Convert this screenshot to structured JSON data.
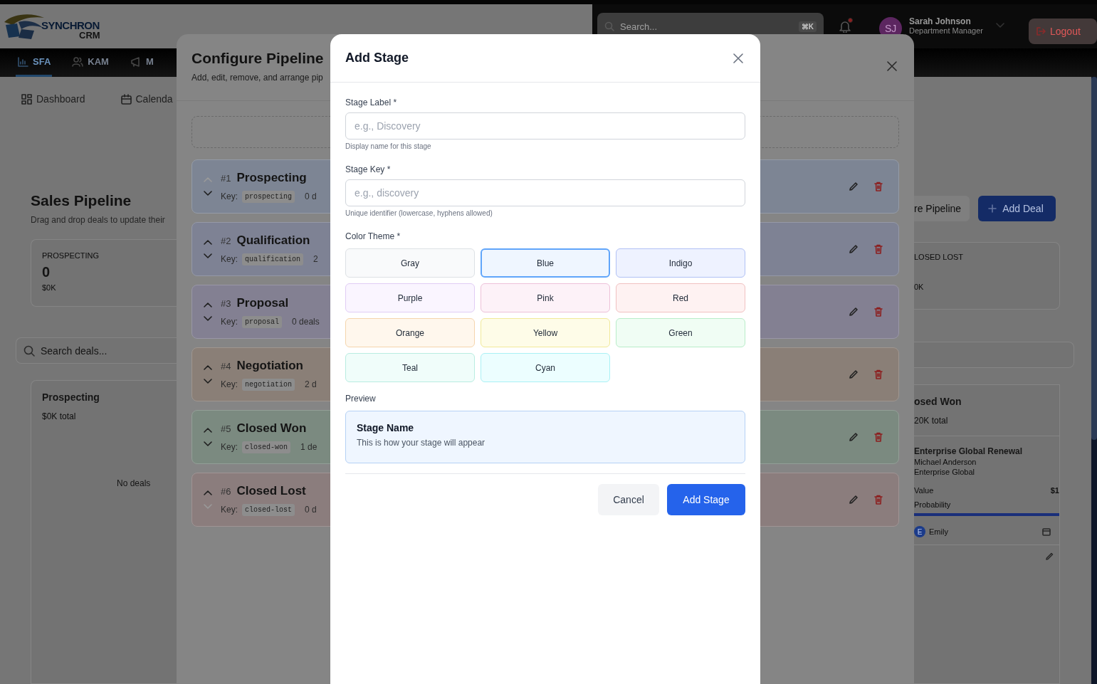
{
  "header": {
    "logo": {
      "word": "SYNCHRON",
      "sub": "CRM"
    },
    "search": {
      "placeholder": "Search...",
      "shortcut": "⌘K"
    },
    "notifications": {
      "unread": true
    },
    "user": {
      "initials": "SJ",
      "name": "Sarah Johnson",
      "role": "Department Manager"
    },
    "logout": "Logout"
  },
  "module_tabs": [
    {
      "label": "SFA",
      "selected": true
    },
    {
      "label": "KAM",
      "selected": false
    },
    {
      "label": "M",
      "selected": false
    }
  ],
  "sub_tabs": [
    {
      "label": "Dashboard"
    },
    {
      "label": "Calenda"
    }
  ],
  "pipeline_page": {
    "title": "Sales Pipeline",
    "subtitle": "Drag and drop deals to update their",
    "configure_button": "re Pipeline",
    "add_deal_button": "Add Deal",
    "stat_cards": [
      {
        "label": "PROSPECTING",
        "count": "0",
        "value": "$0K"
      },
      {
        "label": "LOSED LOST",
        "value": "0K"
      }
    ],
    "search_placeholder": "Search deals...",
    "columns": [
      {
        "title": "Prospecting",
        "total": "$0K total",
        "empty_text": "No deals"
      },
      {
        "title": "osed Won",
        "total": "20K total",
        "deals": [
          {
            "title": "Enterprise Global Renewal",
            "contact": "Michael Anderson",
            "company": "Enterprise Global",
            "value_label": "Value",
            "value": "$1",
            "probability_label": "Probability",
            "level": 1,
            "owner_initial": "E",
            "owner": "Emily"
          }
        ]
      }
    ]
  },
  "configure_pipeline": {
    "title": "Configure Pipeline",
    "subtitle": "Add, edit, remove, and arrange pip",
    "stages": [
      {
        "number": "#1",
        "name": "Prospecting",
        "key_label": "Key:",
        "key": "prospecting",
        "deals": "0 d",
        "color": "#7d8594",
        "up_disabled": true,
        "down_disabled": false
      },
      {
        "number": "#2",
        "name": "Qualification",
        "key_label": "Key:",
        "key": "qualification",
        "deals": "2",
        "color": "#7e8294",
        "up_disabled": false,
        "down_disabled": false
      },
      {
        "number": "#3",
        "name": "Proposal",
        "key_label": "Key:",
        "key": "proposal",
        "deals": "0 deals",
        "color": "#838092",
        "up_disabled": false,
        "down_disabled": false
      },
      {
        "number": "#4",
        "name": "Negotiation",
        "key_label": "Key:",
        "key": "negotiation",
        "deals": "2 d",
        "color": "#8a7f77",
        "up_disabled": false,
        "down_disabled": false
      },
      {
        "number": "#5",
        "name": "Closed Won",
        "key_label": "Key:",
        "key": "closed-won",
        "deals": "1 de",
        "color": "#7b8a80",
        "up_disabled": false,
        "down_disabled": false
      },
      {
        "number": "#6",
        "name": "Closed Lost",
        "key_label": "Key:",
        "key": "closed-lost",
        "deals": "0 d",
        "color": "#8b7d7d",
        "up_disabled": false,
        "down_disabled": true
      }
    ]
  },
  "add_stage": {
    "title": "Add Stage",
    "fields": [
      {
        "label": "Stage Label *",
        "placeholder": "e.g., Discovery",
        "help": "Display name for this stage"
      },
      {
        "label": "Stage Key *",
        "placeholder": "e.g., discovery",
        "help": "Unique identifier (lowercase, hyphens allowed)"
      }
    ],
    "color_label": "Color Theme *",
    "themes": [
      {
        "name": "Gray",
        "color": "#f9fafb",
        "selected": false
      },
      {
        "name": "Blue",
        "color": "#eff6ff",
        "selected": true
      },
      {
        "name": "Indigo",
        "color": "#eef2ff",
        "selected": false
      },
      {
        "name": "Purple",
        "color": "#faf5ff",
        "selected": false
      },
      {
        "name": "Pink",
        "color": "#fdf2f8",
        "selected": false
      },
      {
        "name": "Red",
        "color": "#fef2f2",
        "selected": false
      },
      {
        "name": "Orange",
        "color": "#fff7ed",
        "selected": false
      },
      {
        "name": "Yellow",
        "color": "#fefce8",
        "selected": false
      },
      {
        "name": "Green",
        "color": "#f0fdf4",
        "selected": false
      },
      {
        "name": "Teal",
        "color": "#f0fdfa",
        "selected": false
      },
      {
        "name": "Cyan",
        "color": "#ecfeff",
        "selected": false
      }
    ],
    "preview_label": "Preview",
    "preview": {
      "title": "Stage Name",
      "text": "This is how your stage will appear"
    },
    "cancel_button": "Cancel",
    "submit_button": "Add Stage"
  }
}
